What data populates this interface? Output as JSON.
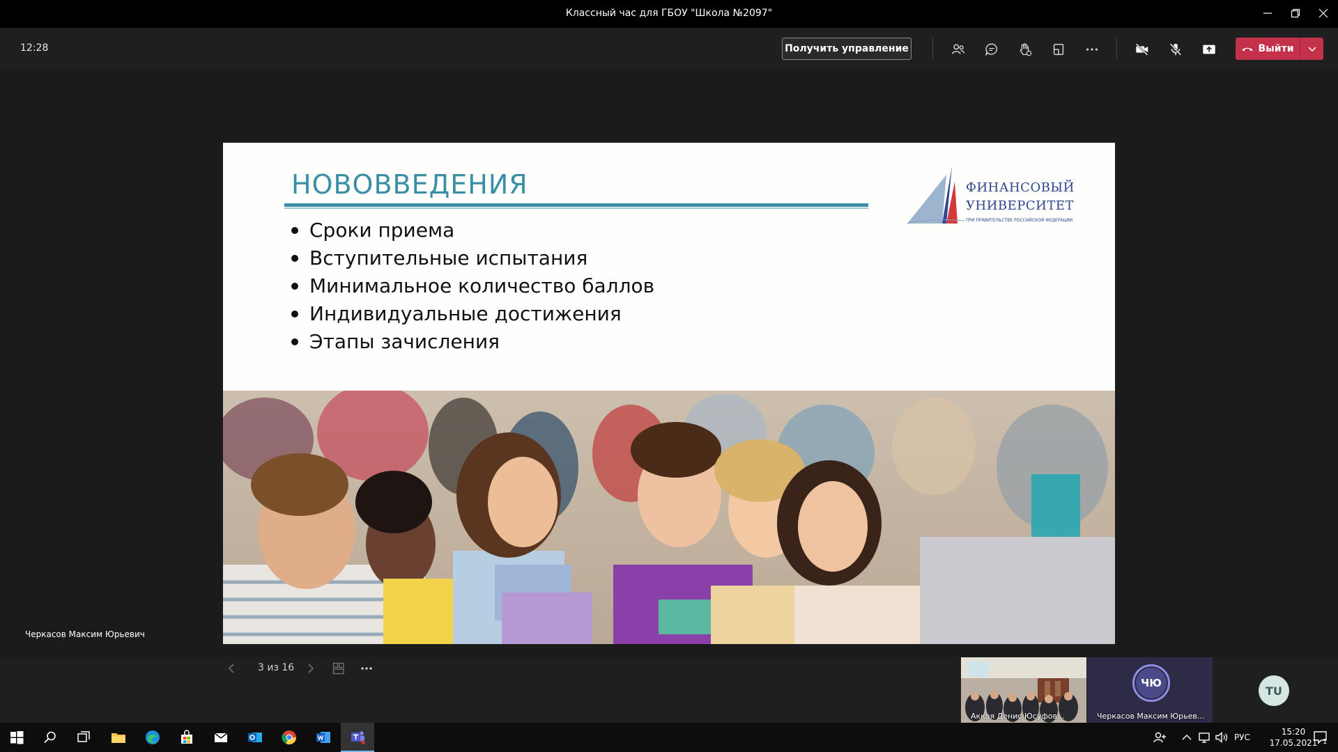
{
  "window": {
    "title": "Классный час для ГБОУ \"Школа №2097\""
  },
  "toolbar": {
    "clock": "12:28",
    "take_control_label": "Получить управление",
    "leave_label": "Выйти",
    "leave_color": "#c4314b"
  },
  "slide": {
    "title": "НОВОВВЕДЕНИЯ",
    "bullets": [
      "Сроки приема",
      "Вступительные испытания",
      "Минимальное количество баллов",
      "Индивидуальные достижения",
      "Этапы зачисления"
    ],
    "logo": {
      "line1": "ФИНАНСОВЫЙ",
      "line2": "УНИВЕРСИТЕТ",
      "line3": "ПРИ ПРАВИТЕЛЬСТВЕ РОССИЙСКОЙ ФЕДЕРАЦИИ"
    },
    "accent_color": "#3a8ea6"
  },
  "slide_nav": {
    "counter": "3 из 16"
  },
  "presenter": {
    "name": "Черкасов Максим Юрьевич"
  },
  "participants": [
    {
      "name": "Аккая Денис Юсуфов...",
      "type": "video"
    },
    {
      "name": "Черкасов Максим Юрьев...",
      "initials": "ЧЮ",
      "type": "avatar"
    },
    {
      "initials": "TU",
      "type": "avatar"
    }
  ],
  "taskbar": {
    "lang": "РУС",
    "time": "15:20",
    "date": "17.05.2021",
    "notifications": "1"
  }
}
